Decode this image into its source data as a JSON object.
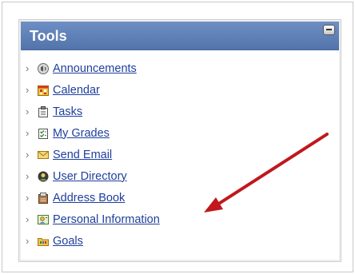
{
  "module": {
    "title": "Tools",
    "collapse_icon": "minimize-icon"
  },
  "tools": [
    {
      "label": "Announcements",
      "icon": "megaphone-icon"
    },
    {
      "label": "Calendar",
      "icon": "calendar-icon"
    },
    {
      "label": "Tasks",
      "icon": "clipboard-icon"
    },
    {
      "label": "My Grades",
      "icon": "grades-icon"
    },
    {
      "label": "Send Email",
      "icon": "envelope-icon"
    },
    {
      "label": "User Directory",
      "icon": "directory-icon"
    },
    {
      "label": "Address Book",
      "icon": "address-book-icon"
    },
    {
      "label": "Personal Information",
      "icon": "personal-info-icon"
    },
    {
      "label": "Goals",
      "icon": "folder-icon"
    }
  ],
  "colors": {
    "header": "#5e80b8",
    "link": "#1f3f9c",
    "arrow": "#c0181d",
    "panel": "#eeeeee"
  },
  "annotation": {
    "type": "pointer-arrow",
    "target": "Personal Information"
  }
}
